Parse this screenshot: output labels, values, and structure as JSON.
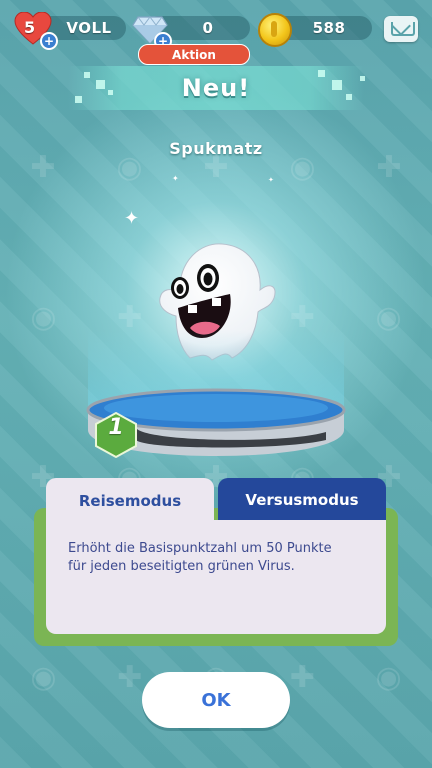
{
  "status_bar": {
    "hearts_count": "5",
    "hearts_status": "VOLL",
    "diamonds": "0",
    "coins": "588"
  },
  "promo_tag": "Aktion",
  "banner_title": "Neu!",
  "character": {
    "name": "Spukmatz",
    "level": "1"
  },
  "tabs": [
    {
      "label": "Reisemodus",
      "selected": false
    },
    {
      "label": "Versusmodus",
      "selected": true
    }
  ],
  "skill_description_line1": "Erhöht die Basispunktzahl um 50 Punkte",
  "skill_description_line2": "für jeden beseitigten grünen Virus.",
  "ok_button": "OK",
  "colors": {
    "background": "#5eaab1",
    "tab_active": "#24489b",
    "panel_frame": "#7bb554",
    "promo_tag": "#e4533a",
    "ok_text": "#3a72d8"
  },
  "icons": [
    "heart-icon",
    "plus-icon",
    "diamond-icon",
    "coin-icon",
    "mail-icon",
    "sparkle-icon",
    "ghost-character",
    "level-hex-icon"
  ]
}
